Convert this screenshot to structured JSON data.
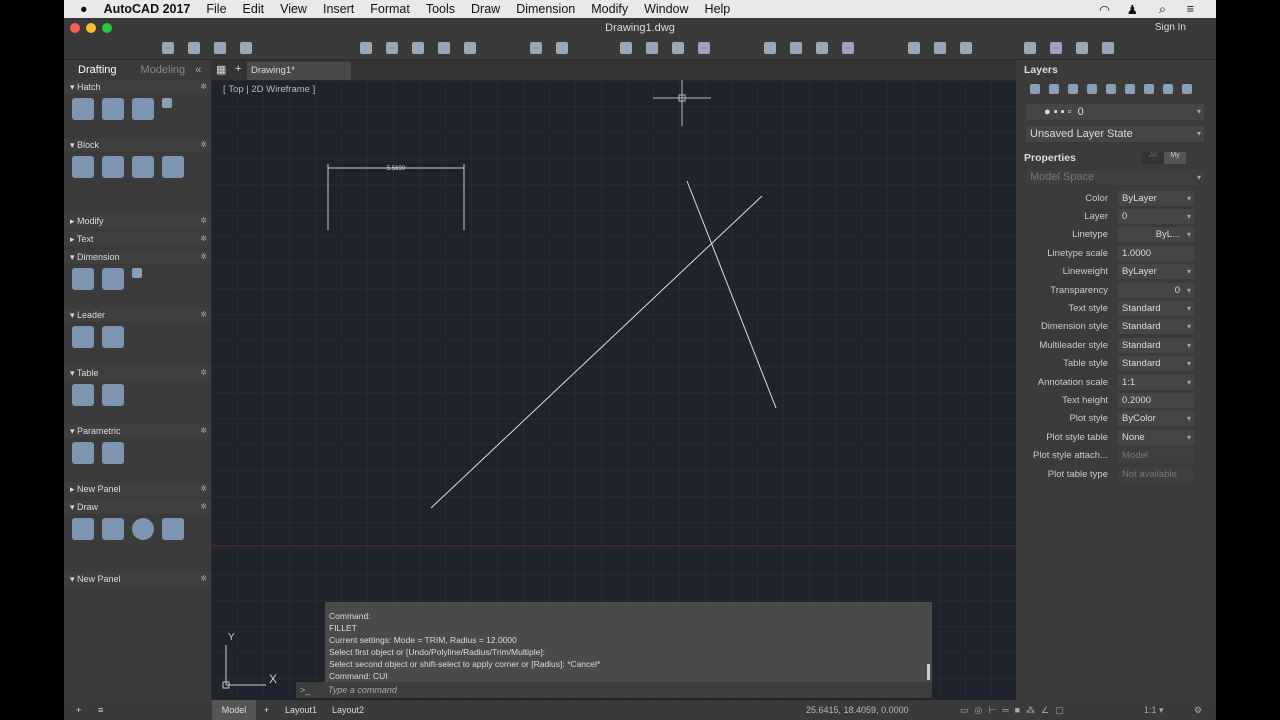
{
  "menubar": {
    "app": "AutoCAD 2017",
    "items": [
      "File",
      "Edit",
      "View",
      "Insert",
      "Format",
      "Tools",
      "Draw",
      "Dimension",
      "Modify",
      "Window",
      "Help"
    ],
    "sign_in": "Sign In"
  },
  "window": {
    "title": "Drawing1.dwg"
  },
  "left_panel": {
    "tabs": [
      "Drafting",
      "Modeling"
    ],
    "sections": [
      "Hatch",
      "Block",
      "Modify",
      "Text",
      "Dimension",
      "Leader",
      "Table",
      "Parametric",
      "New Panel",
      "Draw",
      "New Panel"
    ]
  },
  "doc_tab": "Drawing1*",
  "viewport": {
    "view": "Top",
    "style": "2D Wireframe",
    "dimension": "5.5690"
  },
  "layers": {
    "title": "Layers",
    "current_layer": "0",
    "layer_state": "Unsaved Layer State"
  },
  "properties": {
    "title": "Properties",
    "toggle": [
      "All",
      "My"
    ],
    "space": "Model Space",
    "rows": [
      {
        "label": "Color",
        "value": "ByLayer",
        "kind": "dd"
      },
      {
        "label": "Layer",
        "value": "0",
        "kind": "dd"
      },
      {
        "label": "Linetype",
        "value": "ByL...",
        "kind": "dd"
      },
      {
        "label": "Linetype scale",
        "value": "1.0000",
        "kind": ""
      },
      {
        "label": "Lineweight",
        "value": "ByLayer",
        "kind": "dd"
      },
      {
        "label": "Transparency",
        "value": "0",
        "kind": "dd"
      },
      {
        "label": "Text style",
        "value": "Standard",
        "kind": "dd"
      },
      {
        "label": "Dimension style",
        "value": "Standard",
        "kind": "dd"
      },
      {
        "label": "Multileader style",
        "value": "Standard",
        "kind": "dd"
      },
      {
        "label": "Table style",
        "value": "Standard",
        "kind": "dd"
      },
      {
        "label": "Annotation scale",
        "value": "1:1",
        "kind": "dd"
      },
      {
        "label": "Text height",
        "value": "0.2000",
        "kind": ""
      },
      {
        "label": "Plot style",
        "value": "ByColor",
        "kind": "dd"
      },
      {
        "label": "Plot style table",
        "value": "None",
        "kind": "dd"
      },
      {
        "label": "Plot style attach...",
        "value": "Model",
        "kind": "dis"
      },
      {
        "label": "Plot table type",
        "value": "Not available",
        "kind": "dis"
      }
    ]
  },
  "command": {
    "history": [
      "Command:",
      "FILLET",
      "Current settings: Mode = TRIM, Radius = 12.0000",
      "Select first object or [Undo/Polyline/Radius/Trim/Multiple]:",
      "Select second object or shift-select to apply corner or [Radius]: *Cancel*",
      "Command: CUI"
    ],
    "placeholder": "Type a command",
    "prompt": ">_"
  },
  "status": {
    "tabs": [
      "Model",
      "Layout1",
      "Layout2"
    ],
    "coords": "25.6415, 18.4059, 0.0000",
    "scale": "1:1"
  },
  "ucs": {
    "y": "Y",
    "x": "X"
  }
}
